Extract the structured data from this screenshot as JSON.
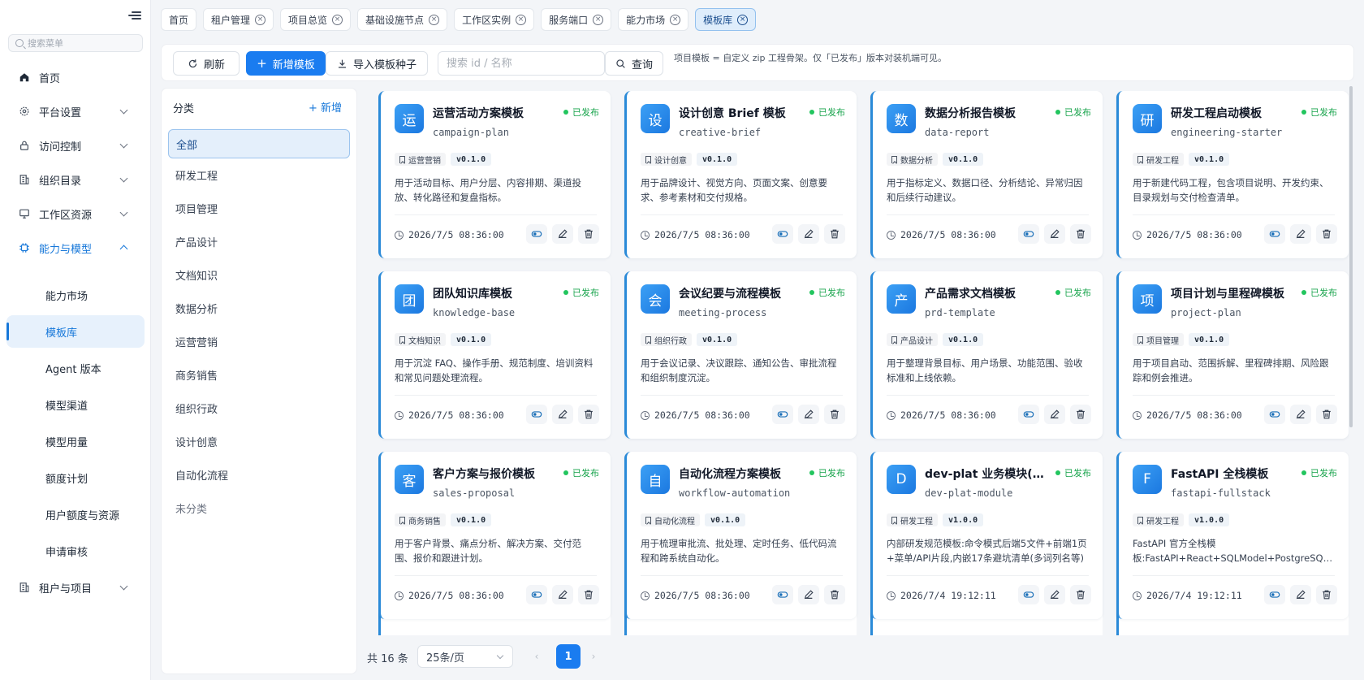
{
  "sidebar": {
    "search_placeholder": "搜索菜单",
    "menu": [
      {
        "label": "首页",
        "icon": "home-icon"
      },
      {
        "label": "平台设置",
        "icon": "gear-icon"
      },
      {
        "label": "访问控制",
        "icon": "lock-icon"
      },
      {
        "label": "组织目录",
        "icon": "directory-icon"
      },
      {
        "label": "工作区资源",
        "icon": "monitor-icon"
      },
      {
        "label": "能力与模型",
        "icon": "chip-icon",
        "expanded": true
      },
      {
        "label": "租户与项目",
        "icon": "building-icon"
      }
    ],
    "submenu": [
      "能力市场",
      "模板库",
      "Agent 版本",
      "模型渠道",
      "模型用量",
      "额度计划",
      "用户额度与资源",
      "申请审核"
    ],
    "active_submenu": "模板库"
  },
  "tabs": [
    {
      "label": "首页",
      "closable": false
    },
    {
      "label": "租户管理",
      "closable": true
    },
    {
      "label": "项目总览",
      "closable": true
    },
    {
      "label": "基础设施节点",
      "closable": true
    },
    {
      "label": "工作区实例",
      "closable": true
    },
    {
      "label": "服务端口",
      "closable": true
    },
    {
      "label": "能力市场",
      "closable": true
    },
    {
      "label": "模板库",
      "closable": true,
      "active": true
    }
  ],
  "toolbar": {
    "refresh_label": "刷新",
    "add_label": "新增模板",
    "import_label": "导入模板种子",
    "search_placeholder": "搜索 id / 名称",
    "query_label": "查询",
    "hint": "项目模板 = 自定义 zip 工程骨架。仅「已发布」版本对装机端可见。"
  },
  "categories": {
    "title": "分类",
    "add_label": "新增",
    "items": [
      "全部",
      "研发工程",
      "项目管理",
      "产品设计",
      "文档知识",
      "数据分析",
      "运营营销",
      "商务销售",
      "组织行政",
      "设计创意",
      "自动化流程",
      "未分类"
    ],
    "active": "全部"
  },
  "cards": [
    {
      "avatar": "运",
      "title": "运营活动方案模板",
      "slug": "campaign-plan",
      "status": "已发布",
      "category": "运营营销",
      "version": "v0.1.0",
      "desc": "用于活动目标、用户分层、内容排期、渠道投放、转化路径和复盘指标。",
      "time": "2026/7/5 08:36:00"
    },
    {
      "avatar": "设",
      "title": "设计创意 Brief 模板",
      "slug": "creative-brief",
      "status": "已发布",
      "category": "设计创意",
      "version": "v0.1.0",
      "desc": "用于品牌设计、视觉方向、页面文案、创意要求、参考素材和交付规格。",
      "time": "2026/7/5 08:36:00"
    },
    {
      "avatar": "数",
      "title": "数据分析报告模板",
      "slug": "data-report",
      "status": "已发布",
      "category": "数据分析",
      "version": "v0.1.0",
      "desc": "用于指标定义、数据口径、分析结论、异常归因和后续行动建议。",
      "time": "2026/7/5 08:36:00"
    },
    {
      "avatar": "研",
      "title": "研发工程启动模板",
      "slug": "engineering-starter",
      "status": "已发布",
      "category": "研发工程",
      "version": "v0.1.0",
      "desc": "用于新建代码工程，包含项目说明、开发约束、目录规划与交付检查清单。",
      "time": "2026/7/5 08:36:00"
    },
    {
      "avatar": "团",
      "title": "团队知识库模板",
      "slug": "knowledge-base",
      "status": "已发布",
      "category": "文档知识",
      "version": "v0.1.0",
      "desc": "用于沉淀 FAQ、操作手册、规范制度、培训资料和常见问题处理流程。",
      "time": "2026/7/5 08:36:00"
    },
    {
      "avatar": "会",
      "title": "会议纪要与流程模板",
      "slug": "meeting-process",
      "status": "已发布",
      "category": "组织行政",
      "version": "v0.1.0",
      "desc": "用于会议记录、决议跟踪、通知公告、审批流程和组织制度沉淀。",
      "time": "2026/7/5 08:36:00"
    },
    {
      "avatar": "产",
      "title": "产品需求文档模板",
      "slug": "prd-template",
      "status": "已发布",
      "category": "产品设计",
      "version": "v0.1.0",
      "desc": "用于整理背景目标、用户场景、功能范围、验收标准和上线依赖。",
      "time": "2026/7/5 08:36:00"
    },
    {
      "avatar": "项",
      "title": "项目计划与里程碑模板",
      "slug": "project-plan",
      "status": "已发布",
      "category": "项目管理",
      "version": "v0.1.0",
      "desc": "用于项目启动、范围拆解、里程碑排期、风险跟踪和例会推进。",
      "time": "2026/7/5 08:36:00"
    },
    {
      "avatar": "客",
      "title": "客户方案与报价模板",
      "slug": "sales-proposal",
      "status": "已发布",
      "category": "商务销售",
      "version": "v0.1.0",
      "desc": "用于客户背景、痛点分析、解决方案、交付范围、报价和跟进计划。",
      "time": "2026/7/5 08:36:00"
    },
    {
      "avatar": "自",
      "title": "自动化流程方案模板",
      "slug": "workflow-automation",
      "status": "已发布",
      "category": "自动化流程",
      "version": "v0.1.0",
      "desc": "用于梳理审批流、批处理、定时任务、低代码流程和跨系统自动化。",
      "time": "2026/7/5 08:36:00"
    },
    {
      "avatar": "D",
      "title": "dev-plat 业务模块(内部研发)",
      "slug": "dev-plat-module",
      "status": "已发布",
      "category": "研发工程",
      "version": "v1.0.0",
      "desc": "内部研发规范模板:命令模式后端5文件+前端1页+菜单/API片段,内嵌17条避坑清单(多词列名等)",
      "time": "2026/7/4 19:12:11"
    },
    {
      "avatar": "F",
      "title": "FastAPI 全栈模板",
      "slug": "fastapi-fullstack",
      "status": "已发布",
      "category": "研发工程",
      "version": "v1.0.0",
      "desc": "FastAPI 官方全栈模板:FastAPI+React+SQLModel+PostgreSQL,含用户认证",
      "time": "2026/7/4 19:12:11"
    }
  ],
  "pagination": {
    "total": "共 16 条",
    "page_size": "25条/页",
    "current_page": "1"
  },
  "colors": {
    "accent": "#1a7cf0",
    "published": "#16a34a",
    "active_bg": "#e7f1fc"
  }
}
